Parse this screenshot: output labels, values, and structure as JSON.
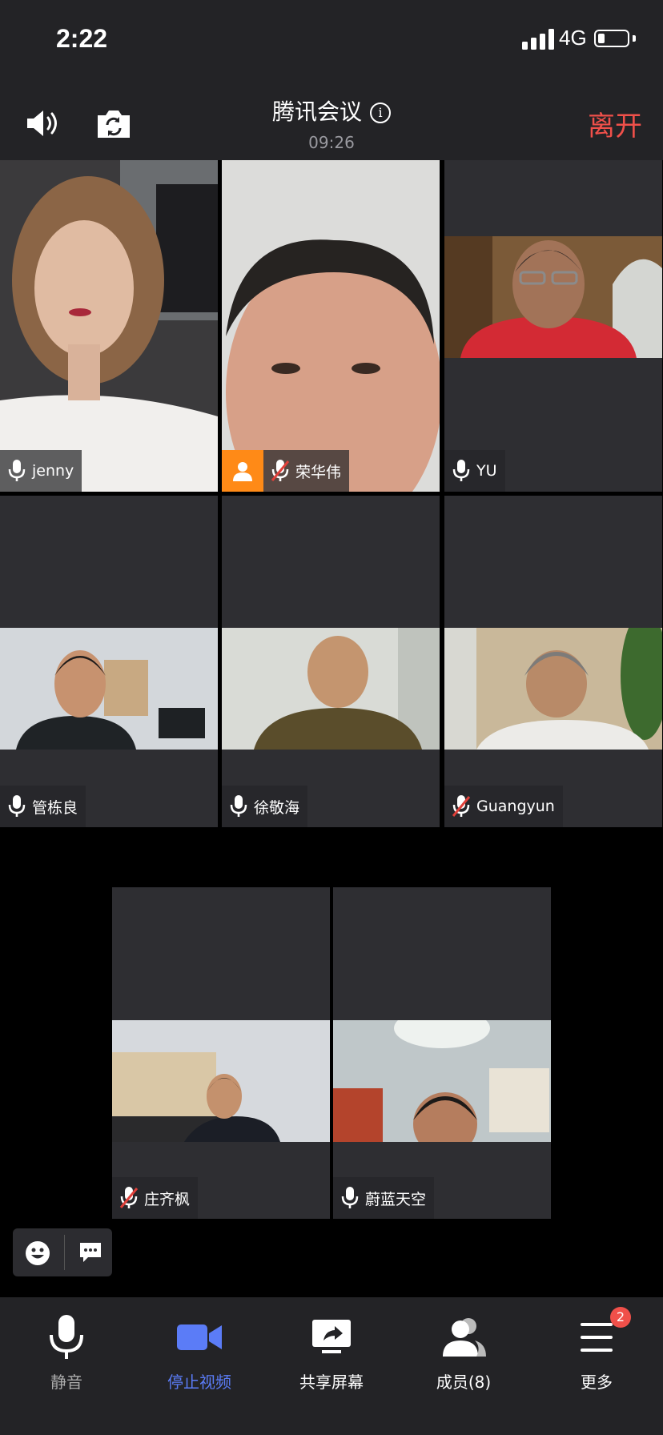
{
  "status_bar": {
    "time": "2:22",
    "network": "4G"
  },
  "header": {
    "title": "腾讯会议",
    "timer": "09:26",
    "leave_label": "离开"
  },
  "participants": [
    {
      "name": "jenny",
      "mic": "on"
    },
    {
      "name": "荣华伟",
      "mic": "muted",
      "avatar": "person-icon"
    },
    {
      "name": "YU",
      "mic": "on"
    },
    {
      "name": "管栋良",
      "mic": "on"
    },
    {
      "name": "徐敬海",
      "mic": "on"
    },
    {
      "name": "Guangyun",
      "mic": "muted"
    },
    {
      "name": "庄齐枫",
      "mic": "muted"
    },
    {
      "name": "蔚蓝天空",
      "mic": "on"
    }
  ],
  "toolbar": {
    "mute": {
      "label": "静音",
      "icon": "microphone-icon"
    },
    "video": {
      "label": "停止视频",
      "icon": "video-camera-icon",
      "color": "#5b7cf7"
    },
    "share": {
      "label": "共享屏幕",
      "icon": "share-screen-icon"
    },
    "members": {
      "label": "成员(8)",
      "icon": "members-icon"
    },
    "more": {
      "label": "更多",
      "icon": "menu-icon",
      "badge": "2"
    }
  },
  "colors": {
    "accent_red": "#f0504a",
    "accent_blue": "#5b7cf7",
    "avatar_orange": "#ff8a17",
    "tile_bg": "#2e2e32"
  }
}
